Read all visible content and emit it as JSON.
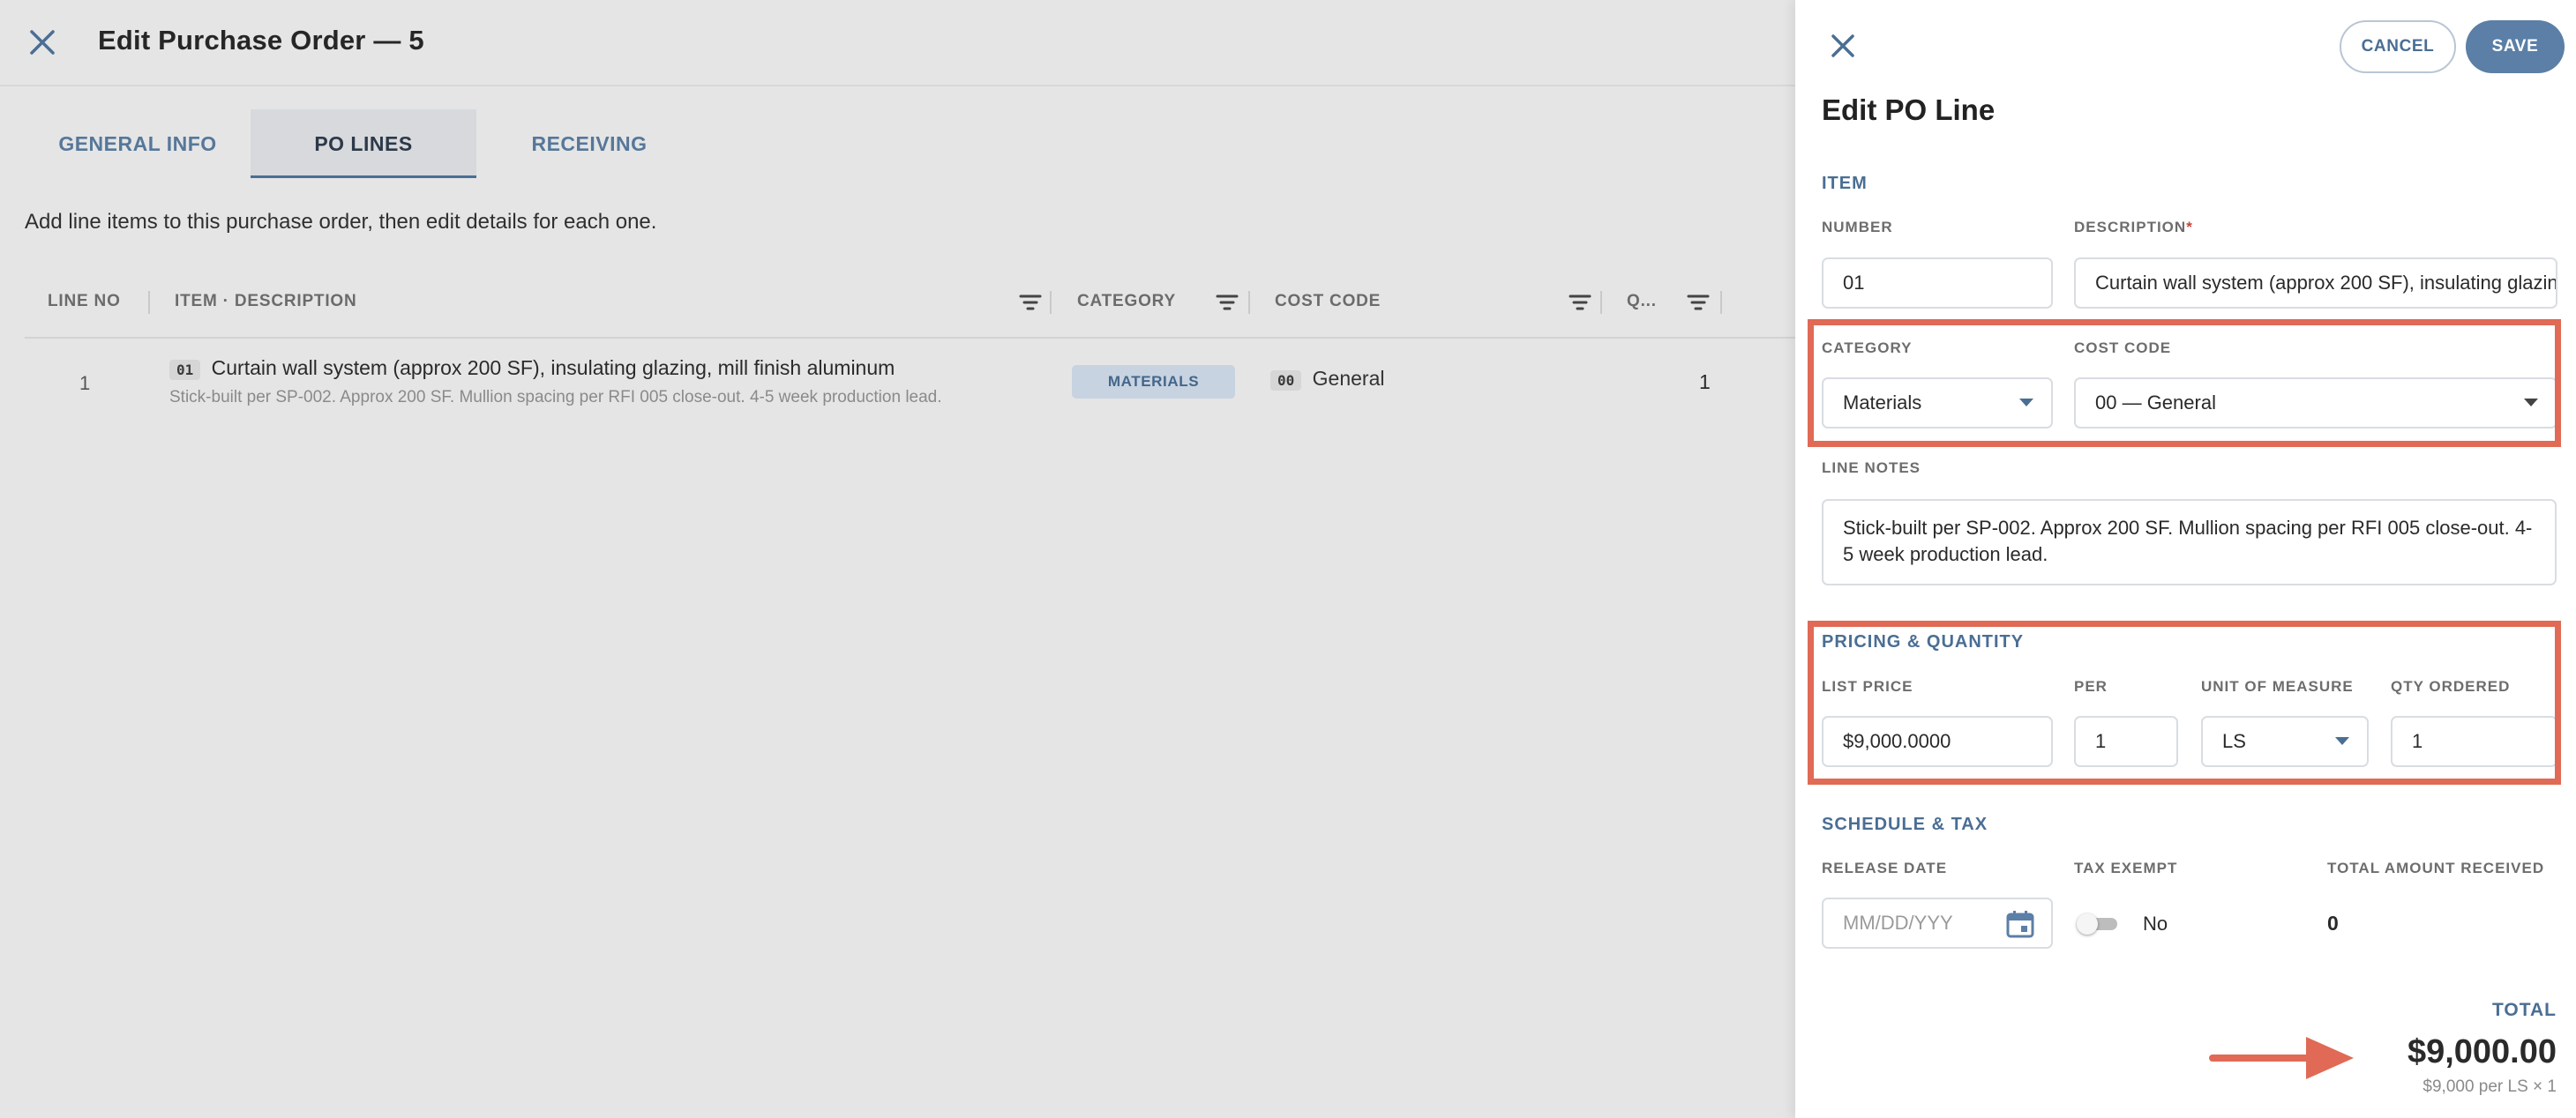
{
  "header": {
    "title": "Edit Purchase Order — 5"
  },
  "tabs": [
    {
      "label": "GENERAL INFO"
    },
    {
      "label": "PO LINES"
    },
    {
      "label": "RECEIVING"
    }
  ],
  "hint": "Add line items to this purchase order, then edit details for each one.",
  "grid": {
    "columns": [
      "LINE NO",
      "ITEM · DESCRIPTION",
      "CATEGORY",
      "COST CODE",
      "Q..."
    ],
    "rows": [
      {
        "line_no": "1",
        "item_code": "01",
        "item_name": "Curtain wall system (approx 200 SF), insulating glazing, mill finish aluminum",
        "item_note": "Stick-built per SP-002. Approx 200 SF. Mullion spacing per RFI 005 close-out. 4-5 week production lead.",
        "category": "MATERIALS",
        "cost_code_chip": "00",
        "cost_code_name": "General",
        "qty": "1"
      }
    ]
  },
  "drawer": {
    "title": "Edit PO Line",
    "cancel_label": "CANCEL",
    "save_label": "SAVE",
    "item_section": "ITEM",
    "number_label": "NUMBER",
    "number_value": "01",
    "description_label": "DESCRIPTION",
    "description_required": "*",
    "description_value": "Curtain wall system (approx 200 SF), insulating glazing, mill finish aluminum",
    "category_label": "CATEGORY",
    "category_value": "Materials",
    "cost_code_label": "COST CODE",
    "cost_code_value": "00 — General",
    "line_notes_label": "LINE NOTES",
    "line_notes_value": "Stick-built per SP-002. Approx 200 SF. Mullion spacing per RFI 005 close-out. 4-5 week production lead.",
    "pricing_section": "PRICING & QUANTITY",
    "list_price_label": "LIST PRICE",
    "list_price_value": "$9,000.0000",
    "per_label": "PER",
    "per_value": "1",
    "uom_label": "UNIT OF MEASURE",
    "uom_value": "LS",
    "qty_label": "QTY ORDERED",
    "qty_value": "1",
    "schedule_section": "SCHEDULE & TAX",
    "release_date_label": "RELEASE DATE",
    "release_date_placeholder": "MM/DD/YYY",
    "tax_exempt_label": "TAX EXEMPT",
    "tax_exempt_value": "No",
    "total_received_label": "TOTAL AMOUNT RECEIVED",
    "total_received_value": "0",
    "total_label": "TOTAL",
    "total_value": "$9,000.00",
    "total_sub": "$9,000 per LS × 1"
  },
  "colors": {
    "accent": "#4a6e94",
    "highlight": "#e06a55",
    "save": "#5b7fa6"
  }
}
